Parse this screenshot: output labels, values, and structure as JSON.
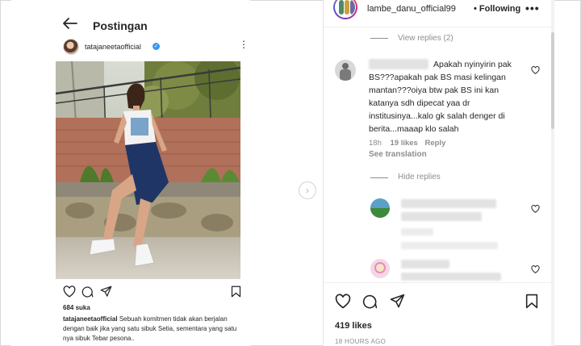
{
  "left": {
    "title": "Postingan",
    "username": "tatajaneetaofficial",
    "likes": "684 suka",
    "caption_user": "tatajaneetaofficial",
    "caption_text": "Sebuah komitmen tidak akan berjalan dengan baik jika yang satu sibuk Setia, sementara yang satu nya sibuk Tebar pesona.."
  },
  "right": {
    "header": {
      "username": "lambe_danu_official99",
      "separator": "•",
      "follow_label": "Following",
      "more": "•••"
    },
    "view_replies": "View replies (2)",
    "comment": {
      "text_lines": [
        "Apakah nyinyirin pak",
        "BS???apakah pak BS masi kelingan",
        "mantan???oiya btw pak BS ini kan",
        "katanya sdh dipecat yaa dr",
        "institusinya...kalo gk salah denger di",
        "berita...maaap klo salah"
      ],
      "age": "18h",
      "likes": "19 likes",
      "reply": "Reply",
      "see_translation": "See translation"
    },
    "hide_replies": "Hide replies",
    "post_likes": "419 likes",
    "timestamp": "18 HOURS AGO"
  },
  "colors": {
    "text": "#262626",
    "muted": "#8e8e8e",
    "verified": "#3897f0",
    "story_ring": [
      "#f58529",
      "#dd2a7b",
      "#8134af",
      "#515bd4"
    ]
  }
}
